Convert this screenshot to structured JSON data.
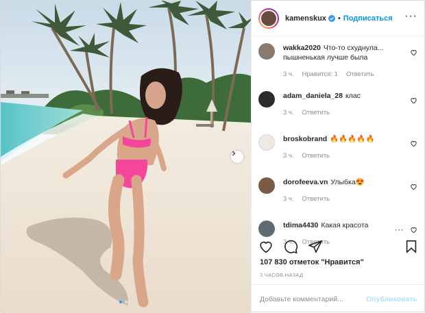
{
  "post": {
    "username": "kamenskux",
    "separator": "•",
    "follow_label": "Подписаться",
    "more_label": "···",
    "image_alt_icon": "photo",
    "carousel": {
      "total": 2,
      "active": 1
    }
  },
  "comments": [
    {
      "user": "wakka2020",
      "text": "Что-то схуднула... пышненькая лучше была",
      "time": "3 ч.",
      "likes": "Нравится: 1",
      "reply": "Ответить"
    },
    {
      "user": "adam_daniela_28",
      "text": "клас",
      "time": "3 ч.",
      "likes": "",
      "reply": "Ответить"
    },
    {
      "user": "broskobrand",
      "text": "🔥🔥🔥🔥🔥",
      "time": "3 ч.",
      "likes": "",
      "reply": "Ответить"
    },
    {
      "user": "dorofeeva.vn",
      "text": "Улыбка😍",
      "time": "3 ч.",
      "likes": "",
      "reply": "Ответить"
    },
    {
      "user": "tdima4430",
      "text": "Какая красота",
      "time": "3 ч.",
      "likes": "",
      "reply": "Ответить",
      "more": "···"
    }
  ],
  "footer": {
    "likes": "107 830 отметок \"Нравится\"",
    "time": "3 ЧАСОВ НАЗАД",
    "comment_placeholder": "Добавьте комментарий...",
    "publish_label": "Опубликовать"
  },
  "colors": {
    "accent": "#0095f6",
    "text": "#262626",
    "muted": "#8e8e8e",
    "publish_disabled": "#b2dffc"
  }
}
